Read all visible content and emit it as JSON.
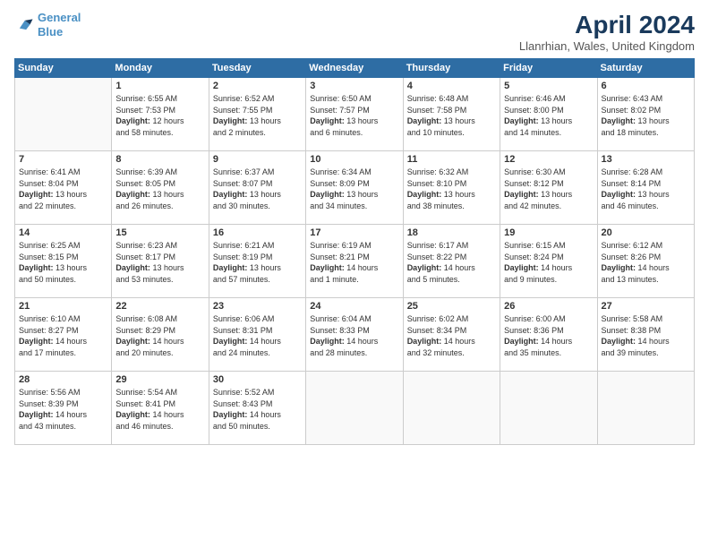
{
  "logo": {
    "line1": "General",
    "line2": "Blue"
  },
  "title": "April 2024",
  "subtitle": "Llanrhian, Wales, United Kingdom",
  "headers": [
    "Sunday",
    "Monday",
    "Tuesday",
    "Wednesday",
    "Thursday",
    "Friday",
    "Saturday"
  ],
  "weeks": [
    [
      {
        "day": "",
        "info": []
      },
      {
        "day": "1",
        "info": [
          "Sunrise: 6:55 AM",
          "Sunset: 7:53 PM",
          "Daylight: 12 hours",
          "and 58 minutes."
        ]
      },
      {
        "day": "2",
        "info": [
          "Sunrise: 6:52 AM",
          "Sunset: 7:55 PM",
          "Daylight: 13 hours",
          "and 2 minutes."
        ]
      },
      {
        "day": "3",
        "info": [
          "Sunrise: 6:50 AM",
          "Sunset: 7:57 PM",
          "Daylight: 13 hours",
          "and 6 minutes."
        ]
      },
      {
        "day": "4",
        "info": [
          "Sunrise: 6:48 AM",
          "Sunset: 7:58 PM",
          "Daylight: 13 hours",
          "and 10 minutes."
        ]
      },
      {
        "day": "5",
        "info": [
          "Sunrise: 6:46 AM",
          "Sunset: 8:00 PM",
          "Daylight: 13 hours",
          "and 14 minutes."
        ]
      },
      {
        "day": "6",
        "info": [
          "Sunrise: 6:43 AM",
          "Sunset: 8:02 PM",
          "Daylight: 13 hours",
          "and 18 minutes."
        ]
      }
    ],
    [
      {
        "day": "7",
        "info": [
          "Sunrise: 6:41 AM",
          "Sunset: 8:04 PM",
          "Daylight: 13 hours",
          "and 22 minutes."
        ]
      },
      {
        "day": "8",
        "info": [
          "Sunrise: 6:39 AM",
          "Sunset: 8:05 PM",
          "Daylight: 13 hours",
          "and 26 minutes."
        ]
      },
      {
        "day": "9",
        "info": [
          "Sunrise: 6:37 AM",
          "Sunset: 8:07 PM",
          "Daylight: 13 hours",
          "and 30 minutes."
        ]
      },
      {
        "day": "10",
        "info": [
          "Sunrise: 6:34 AM",
          "Sunset: 8:09 PM",
          "Daylight: 13 hours",
          "and 34 minutes."
        ]
      },
      {
        "day": "11",
        "info": [
          "Sunrise: 6:32 AM",
          "Sunset: 8:10 PM",
          "Daylight: 13 hours",
          "and 38 minutes."
        ]
      },
      {
        "day": "12",
        "info": [
          "Sunrise: 6:30 AM",
          "Sunset: 8:12 PM",
          "Daylight: 13 hours",
          "and 42 minutes."
        ]
      },
      {
        "day": "13",
        "info": [
          "Sunrise: 6:28 AM",
          "Sunset: 8:14 PM",
          "Daylight: 13 hours",
          "and 46 minutes."
        ]
      }
    ],
    [
      {
        "day": "14",
        "info": [
          "Sunrise: 6:25 AM",
          "Sunset: 8:15 PM",
          "Daylight: 13 hours",
          "and 50 minutes."
        ]
      },
      {
        "day": "15",
        "info": [
          "Sunrise: 6:23 AM",
          "Sunset: 8:17 PM",
          "Daylight: 13 hours",
          "and 53 minutes."
        ]
      },
      {
        "day": "16",
        "info": [
          "Sunrise: 6:21 AM",
          "Sunset: 8:19 PM",
          "Daylight: 13 hours",
          "and 57 minutes."
        ]
      },
      {
        "day": "17",
        "info": [
          "Sunrise: 6:19 AM",
          "Sunset: 8:21 PM",
          "Daylight: 14 hours",
          "and 1 minute."
        ]
      },
      {
        "day": "18",
        "info": [
          "Sunrise: 6:17 AM",
          "Sunset: 8:22 PM",
          "Daylight: 14 hours",
          "and 5 minutes."
        ]
      },
      {
        "day": "19",
        "info": [
          "Sunrise: 6:15 AM",
          "Sunset: 8:24 PM",
          "Daylight: 14 hours",
          "and 9 minutes."
        ]
      },
      {
        "day": "20",
        "info": [
          "Sunrise: 6:12 AM",
          "Sunset: 8:26 PM",
          "Daylight: 14 hours",
          "and 13 minutes."
        ]
      }
    ],
    [
      {
        "day": "21",
        "info": [
          "Sunrise: 6:10 AM",
          "Sunset: 8:27 PM",
          "Daylight: 14 hours",
          "and 17 minutes."
        ]
      },
      {
        "day": "22",
        "info": [
          "Sunrise: 6:08 AM",
          "Sunset: 8:29 PM",
          "Daylight: 14 hours",
          "and 20 minutes."
        ]
      },
      {
        "day": "23",
        "info": [
          "Sunrise: 6:06 AM",
          "Sunset: 8:31 PM",
          "Daylight: 14 hours",
          "and 24 minutes."
        ]
      },
      {
        "day": "24",
        "info": [
          "Sunrise: 6:04 AM",
          "Sunset: 8:33 PM",
          "Daylight: 14 hours",
          "and 28 minutes."
        ]
      },
      {
        "day": "25",
        "info": [
          "Sunrise: 6:02 AM",
          "Sunset: 8:34 PM",
          "Daylight: 14 hours",
          "and 32 minutes."
        ]
      },
      {
        "day": "26",
        "info": [
          "Sunrise: 6:00 AM",
          "Sunset: 8:36 PM",
          "Daylight: 14 hours",
          "and 35 minutes."
        ]
      },
      {
        "day": "27",
        "info": [
          "Sunrise: 5:58 AM",
          "Sunset: 8:38 PM",
          "Daylight: 14 hours",
          "and 39 minutes."
        ]
      }
    ],
    [
      {
        "day": "28",
        "info": [
          "Sunrise: 5:56 AM",
          "Sunset: 8:39 PM",
          "Daylight: 14 hours",
          "and 43 minutes."
        ]
      },
      {
        "day": "29",
        "info": [
          "Sunrise: 5:54 AM",
          "Sunset: 8:41 PM",
          "Daylight: 14 hours",
          "and 46 minutes."
        ]
      },
      {
        "day": "30",
        "info": [
          "Sunrise: 5:52 AM",
          "Sunset: 8:43 PM",
          "Daylight: 14 hours",
          "and 50 minutes."
        ]
      },
      {
        "day": "",
        "info": []
      },
      {
        "day": "",
        "info": []
      },
      {
        "day": "",
        "info": []
      },
      {
        "day": "",
        "info": []
      }
    ]
  ]
}
